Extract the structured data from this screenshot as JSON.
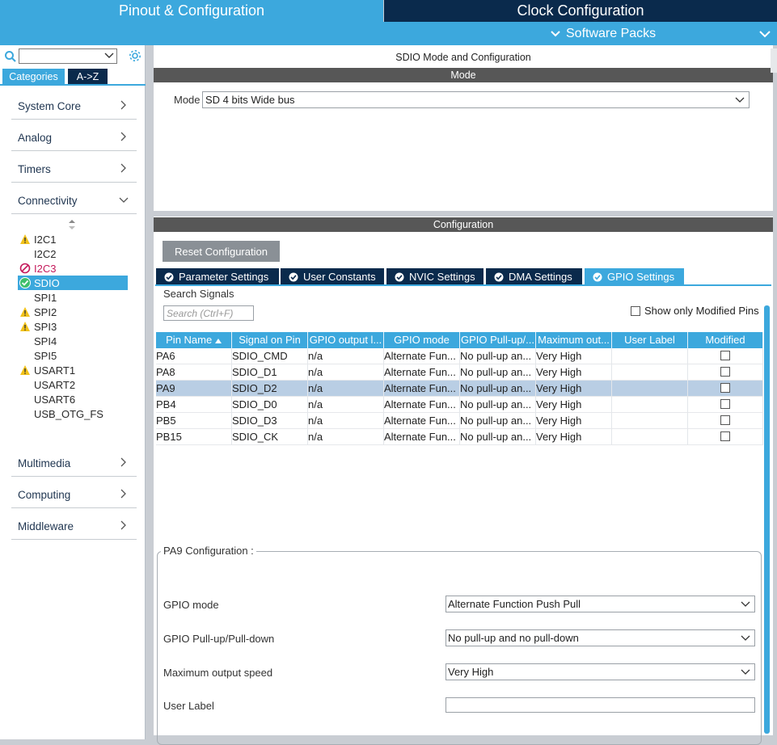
{
  "header": {
    "tab_pinout": "Pinout & Configuration",
    "tab_clock": "Clock Configuration",
    "software_packs": "Software Packs"
  },
  "sidebar": {
    "tabs": [
      "Categories",
      "A->Z"
    ],
    "categories": [
      {
        "label": "System Core"
      },
      {
        "label": "Analog"
      },
      {
        "label": "Timers"
      },
      {
        "label": "Connectivity"
      },
      {
        "label": "Multimedia"
      },
      {
        "label": "Computing"
      },
      {
        "label": "Middleware"
      }
    ],
    "connectivity_items": [
      {
        "label": "I2C1",
        "status": "warning"
      },
      {
        "label": "I2C2",
        "status": "none"
      },
      {
        "label": "I2C3",
        "status": "error"
      },
      {
        "label": "SDIO",
        "status": "ok"
      },
      {
        "label": "SPI1",
        "status": "none"
      },
      {
        "label": "SPI2",
        "status": "warning"
      },
      {
        "label": "SPI3",
        "status": "warning"
      },
      {
        "label": "SPI4",
        "status": "none"
      },
      {
        "label": "SPI5",
        "status": "none"
      },
      {
        "label": "USART1",
        "status": "warning"
      },
      {
        "label": "USART2",
        "status": "none"
      },
      {
        "label": "USART6",
        "status": "none"
      },
      {
        "label": "USB_OTG_FS",
        "status": "none"
      }
    ]
  },
  "mode_panel": {
    "title": "SDIO Mode and Configuration",
    "section": "Mode",
    "mode_label": "Mode",
    "mode_value": "SD 4 bits Wide bus"
  },
  "config_panel": {
    "section": "Configuration",
    "reset_label": "Reset Configuration",
    "tabs": [
      "Parameter Settings",
      "User Constants",
      "NVIC Settings",
      "DMA Settings",
      "GPIO Settings"
    ],
    "search_label": "Search Signals",
    "search_placeholder": "Search (Ctrl+F)",
    "show_modified_label": "Show only Modified Pins",
    "columns": [
      "Pin Name",
      "Signal on Pin",
      "GPIO output l...",
      "GPIO mode",
      "GPIO Pull-up/...",
      "Maximum out...",
      "User Label",
      "Modified"
    ],
    "rows": [
      [
        "PA6",
        "SDIO_CMD",
        "n/a",
        "Alternate Fun...",
        "No pull-up an...",
        "Very High",
        ""
      ],
      [
        "PA8",
        "SDIO_D1",
        "n/a",
        "Alternate Fun...",
        "No pull-up an...",
        "Very High",
        ""
      ],
      [
        "PA9",
        "SDIO_D2",
        "n/a",
        "Alternate Fun...",
        "No pull-up an...",
        "Very High",
        ""
      ],
      [
        "PB4",
        "SDIO_D0",
        "n/a",
        "Alternate Fun...",
        "No pull-up an...",
        "Very High",
        ""
      ],
      [
        "PB5",
        "SDIO_D3",
        "n/a",
        "Alternate Fun...",
        "No pull-up an...",
        "Very High",
        ""
      ],
      [
        "PB15",
        "SDIO_CK",
        "n/a",
        "Alternate Fun...",
        "No pull-up an...",
        "Very High",
        ""
      ]
    ],
    "pin_config": {
      "title": "PA9 Configuration :",
      "gpio_mode_label": "GPIO mode",
      "gpio_mode_value": "Alternate Function Push Pull",
      "pull_label": "GPIO Pull-up/Pull-down",
      "pull_value": "No pull-up and no pull-down",
      "speed_label": "Maximum output speed",
      "speed_value": "Very High",
      "user_label_label": "User Label",
      "user_label_value": ""
    }
  },
  "colors": {
    "accent": "#3ca8dd",
    "navy": "#0a2a4c",
    "dark_bar": "#575757",
    "warning": "#f2c21a",
    "error": "#c4185a",
    "ok": "#3dbf6b"
  }
}
